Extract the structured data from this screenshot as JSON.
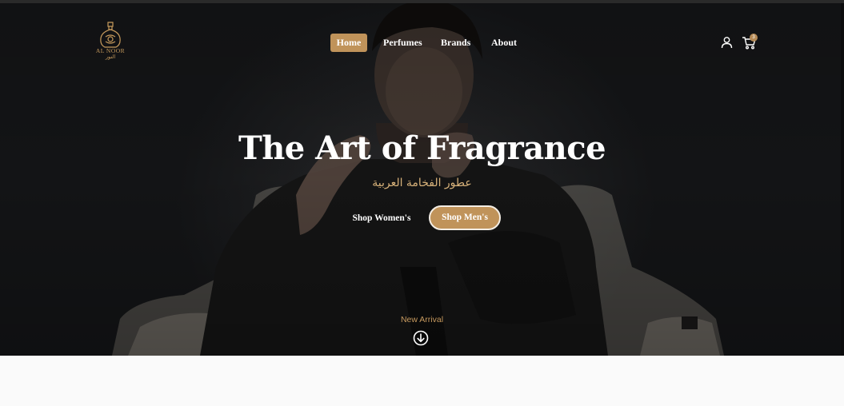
{
  "brand": {
    "logo_name": "AL NOOR",
    "logo_arabic": "النور",
    "logo_icon": "perfume-bottle-icon",
    "accent_color": "#c0935a"
  },
  "nav": {
    "items": [
      {
        "label": "Home",
        "active": true
      },
      {
        "label": "Perfumes",
        "active": false
      },
      {
        "label": "Brands",
        "active": false
      },
      {
        "label": "About",
        "active": false
      }
    ],
    "user_icon": "user-icon",
    "cart_icon": "cart-icon",
    "cart_count": "3"
  },
  "hero": {
    "title": "The Art of Fragrance",
    "subtitle": "عطور الفخامة العربية",
    "cta_women": "Shop Women's",
    "cta_men": "Shop Men's",
    "scroll_label": "New Arrival",
    "scroll_icon": "arrow-down-circle-icon"
  }
}
